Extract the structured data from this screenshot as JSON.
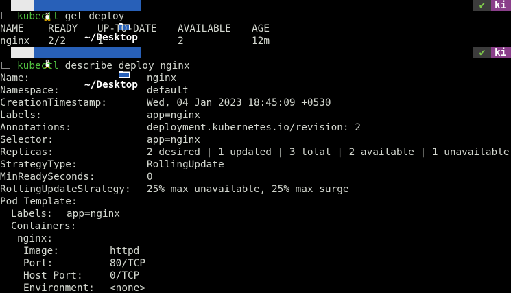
{
  "prompts": [
    {
      "user_icon": "linux-tux-icon",
      "folder_icon": "folder-icon",
      "path": "~/Desktop",
      "status_icon": "check-icon",
      "status_symbol": "✔",
      "context_text": "ki",
      "command": "kubectl",
      "args": " get deploy"
    },
    {
      "user_icon": "linux-tux-icon",
      "folder_icon": "folder-icon",
      "path": "~/Desktop",
      "status_icon": "check-icon",
      "status_symbol": "✔",
      "context_text": "ki",
      "command": "kubectl",
      "args": " describe deploy nginx"
    }
  ],
  "get_deploy": {
    "headers": [
      "NAME",
      "READY",
      "UP-TO-DATE",
      "AVAILABLE",
      "AGE"
    ],
    "rows": [
      [
        "nginx",
        "2/2",
        "1",
        "2",
        "12m"
      ]
    ]
  },
  "describe": {
    "fields": [
      {
        "key": "Name:",
        "value": "nginx"
      },
      {
        "key": "Namespace:",
        "value": "default"
      },
      {
        "key": "CreationTimestamp:",
        "value": "Wed, 04 Jan 2023 18:45:09 +0530"
      },
      {
        "key": "Labels:",
        "value": "app=nginx"
      },
      {
        "key": "Annotations:",
        "value": "deployment.kubernetes.io/revision: 2"
      },
      {
        "key": "Selector:",
        "value": "app=nginx"
      },
      {
        "key": "Replicas:",
        "value": "2 desired | 1 updated | 3 total | 2 available | 1 unavailable"
      },
      {
        "key": "StrategyType:",
        "value": "RollingUpdate"
      },
      {
        "key": "MinReadySeconds:",
        "value": "0"
      },
      {
        "key": "RollingUpdateStrategy:",
        "value": "25% max unavailable, 25% max surge"
      }
    ],
    "pod_template_label": "Pod Template:",
    "pod_labels_key": "Labels:",
    "pod_labels_value": "app=nginx",
    "containers_key": "Containers:",
    "container_name": "nginx:",
    "container_fields": [
      {
        "key": "Image:",
        "value": "httpd"
      },
      {
        "key": "Port:",
        "value": "80/TCP"
      },
      {
        "key": "Host Port:",
        "value": "0/TCP"
      },
      {
        "key": "Environment:",
        "value": "<none>"
      }
    ]
  },
  "colors": {
    "background": "#000000",
    "text": "#d3d7cf",
    "command": "#4fbf3f",
    "path_badge": "#2860b8",
    "status_badge": "#3c3c3c",
    "status_check": "#7ec84a",
    "context_badge": "#8a3f8a"
  }
}
